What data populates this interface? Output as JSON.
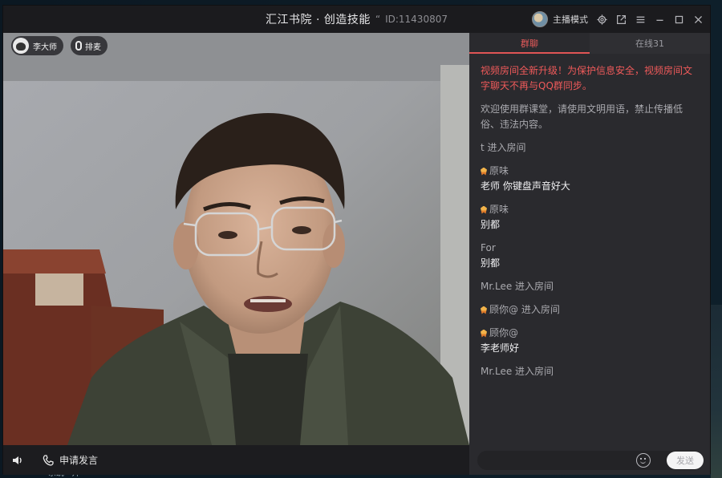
{
  "window": {
    "title": "汇江书院 · 创造技能",
    "title_quote": "“",
    "room_id": "ID:11430807",
    "user_name": "主播模式"
  },
  "video": {
    "host_name": "李大师",
    "mic_label": "排麦"
  },
  "controls": {
    "apply_speak_label": "申请发言"
  },
  "panel": {
    "tabs": [
      {
        "label": "群聊",
        "active": true
      },
      {
        "label": "在线31",
        "active": false
      }
    ],
    "notices": [
      "视频房间全新升级！为保护信息安全，视频房间文字聊天不再与QQ群同步。",
      "欢迎使用群课堂，请使用文明用语，禁止传播低俗、违法内容。"
    ],
    "messages": [
      {
        "kind": "system",
        "text": "t 进入房间"
      },
      {
        "kind": "chat",
        "sender": "原味",
        "medal": true,
        "text": "老师 你键盘声音好大"
      },
      {
        "kind": "chat",
        "sender": "原味",
        "medal": true,
        "text": "别都"
      },
      {
        "kind": "chat",
        "sender": "For",
        "medal": false,
        "text": "别都"
      },
      {
        "kind": "system",
        "text": "Mr.Lee 进入房间"
      },
      {
        "kind": "system-medal",
        "text": "顾你@ 进入房间"
      },
      {
        "kind": "chat",
        "sender": "顾你@",
        "medal": true,
        "text": "李老师好"
      },
      {
        "kind": "system",
        "text": "Mr.Lee 进入房间"
      }
    ],
    "send_label": "发送"
  },
  "desktop": {
    "footer_text": "系统 · 开"
  }
}
